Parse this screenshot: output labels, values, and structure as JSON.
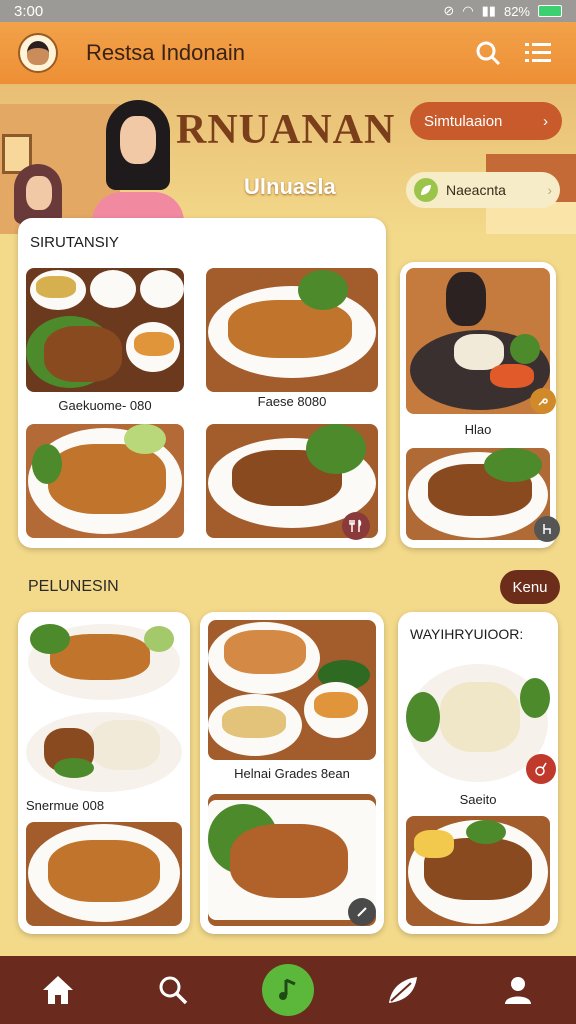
{
  "status": {
    "time": "3:00",
    "battery": "82%"
  },
  "app": {
    "title": "Restsa Indonain"
  },
  "hero": {
    "title": "RNUANAN",
    "subtitle": "Ulnuasla",
    "pill_primary": "Simtulaaion",
    "pill_secondary": "Naeacnta"
  },
  "sections": {
    "first": {
      "title": "SIRUTANSIY",
      "items": [
        {
          "label": "Gaekuome- 080"
        },
        {
          "label": "Faese 8080"
        },
        {
          "label": ""
        },
        {
          "label": ""
        }
      ],
      "side_label": "Hlao"
    },
    "second": {
      "title": "PELUNESIN",
      "button": "Kenu",
      "left_label": "Snermue 008",
      "mid_label": "Helnai Grades 8ean",
      "right_title": "WAYIHRYUIOOR:",
      "right_label": "Saeito"
    }
  },
  "icons": {
    "logo": "chef-logo",
    "search": "search-icon",
    "menu": "menu-icon",
    "nav": [
      "home-icon",
      "search-icon",
      "music-icon",
      "leaf-icon",
      "profile-icon"
    ]
  },
  "colors": {
    "accent": "#ee8f35",
    "brand_dark": "#6a2a1e",
    "active": "#5cb83a"
  }
}
